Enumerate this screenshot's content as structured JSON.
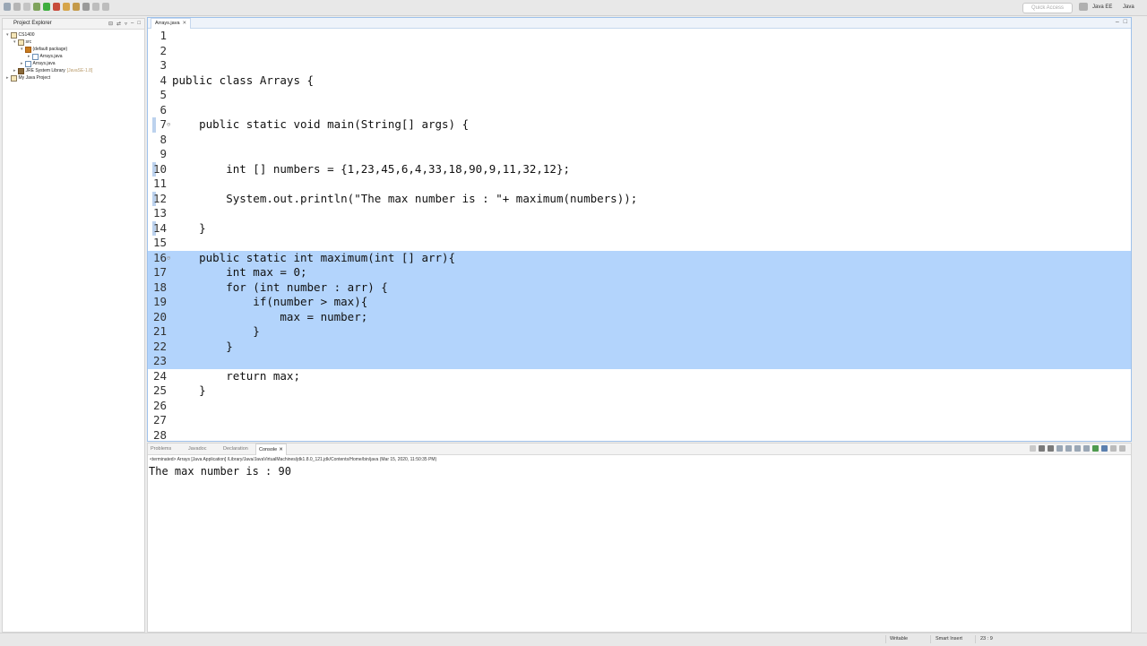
{
  "toolbar": {
    "quick_access_placeholder": "Quick Access",
    "perspective_java_ee": "Java EE",
    "perspective_java": "Java"
  },
  "project_explorer": {
    "title": "Project Explorer",
    "tree": [
      {
        "label": "CS1400",
        "icon": "project-folder-icon"
      },
      {
        "label": "src",
        "icon": "source-folder-icon"
      },
      {
        "label": "(default package)",
        "icon": "package-icon"
      },
      {
        "label": "Arrays.java",
        "icon": "java-file-icon"
      },
      {
        "label": "Arrays.java",
        "icon": "java-file-icon"
      },
      {
        "label": "JRE System Library",
        "note": "[JavaSE-1.8]",
        "icon": "library-icon"
      },
      {
        "label": "My Java Project",
        "icon": "project-folder-icon"
      }
    ]
  },
  "editor": {
    "tab_label": "Arrays.java",
    "lines": [
      "",
      "",
      "",
      "public class Arrays {",
      "",
      "",
      "    public static void main(String[] args) {",
      "",
      "",
      "        int [] numbers = {1,23,45,6,4,33,18,90,9,11,32,12};",
      "",
      "        System.out.println(\"The max number is : \"+ maximum(numbers));",
      "",
      "    }",
      "",
      "    public static int maximum(int [] arr){",
      "        int max = 0;",
      "        for (int number : arr) {",
      "            if(number > max){",
      "                max = number;",
      "            }",
      "        }",
      "        ",
      "        return max;",
      "    }",
      "",
      "",
      ""
    ],
    "line_numbers": [
      "1",
      "2",
      "3",
      "4",
      "5",
      "6",
      "7",
      "8",
      "9",
      "10",
      "11",
      "12",
      "13",
      "14",
      "15",
      "16",
      "17",
      "18",
      "19",
      "20",
      "21",
      "22",
      "23",
      "24",
      "25",
      "26",
      "27",
      "28"
    ]
  },
  "console": {
    "tabs": [
      "Problems",
      "Javadoc",
      "Declaration",
      "Console"
    ],
    "status": "<terminated> Arrays [Java Application] /Library/Java/JavaVirtualMachines/jdk1.8.0_121.jdk/Contents/Home/bin/java (Mar 15, 2020, 11:50:35 PM)",
    "output": "The max number is : 90"
  },
  "statusbar": {
    "writable": "Writable",
    "insert_mode": "Smart Insert",
    "position": "23 : 9"
  },
  "colors": {
    "selection": "#b3d4fc",
    "keyword": "#7f0055",
    "string": "#2a00ff",
    "editor_border": "#9ec1ea"
  }
}
